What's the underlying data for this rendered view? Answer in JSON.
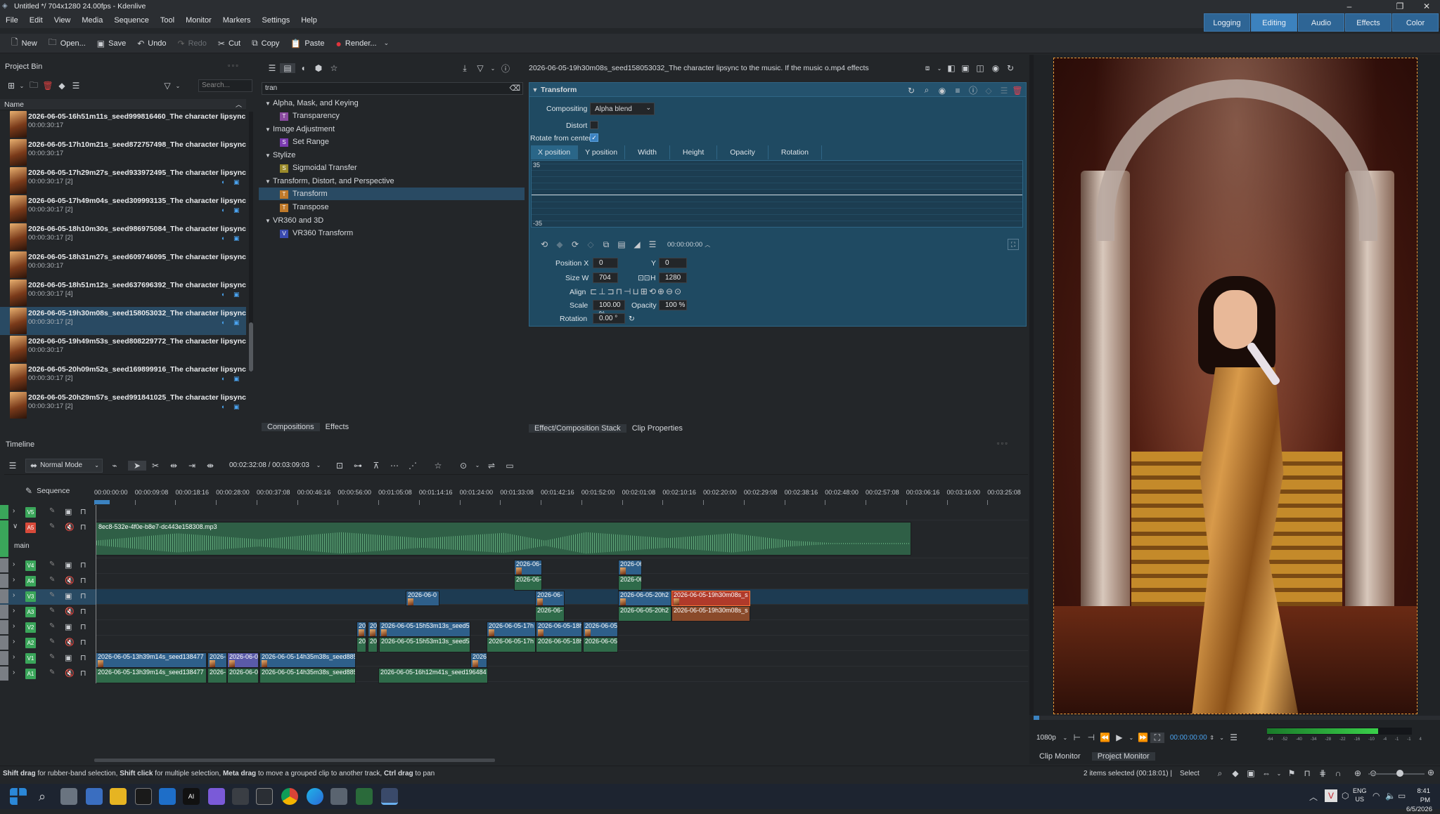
{
  "window": {
    "title": "Untitled */ 704x1280 24.00fps - Kdenlive"
  },
  "menu": [
    "File",
    "Edit",
    "View",
    "Media",
    "Sequence",
    "Tool",
    "Monitor",
    "Markers",
    "Settings",
    "Help"
  ],
  "workspace_tabs": [
    {
      "label": "Logging",
      "active": false
    },
    {
      "label": "Editing",
      "active": true
    },
    {
      "label": "Audio",
      "active": false
    },
    {
      "label": "Effects",
      "active": false
    },
    {
      "label": "Color",
      "active": false
    }
  ],
  "toolbar": {
    "new": "New",
    "open": "Open...",
    "save": "Save",
    "undo": "Undo",
    "redo": "Redo",
    "cut": "Cut",
    "copy": "Copy",
    "paste": "Paste",
    "render": "Render..."
  },
  "project_bin": {
    "title": "Project Bin",
    "search_placeholder": "Search...",
    "column_name": "Name",
    "clips": [
      {
        "name": "2026-06-05-16h51m11s_seed999816460_The character lipsync to the",
        "time": "00:00:30:17",
        "selected": false
      },
      {
        "name": "2026-06-05-17h10m21s_seed872757498_The character lipsync to the",
        "time": "00:00:30:17",
        "selected": false
      },
      {
        "name": "2026-06-05-17h29m27s_seed933972495_The character lipsync to the",
        "time": "00:00:30:17 [2]",
        "selected": false
      },
      {
        "name": "2026-06-05-17h49m04s_seed309993135_The character lipsync to the",
        "time": "00:00:30:17 [2]",
        "selected": false
      },
      {
        "name": "2026-06-05-18h10m30s_seed986975084_The character lipsync to the",
        "time": "00:00:30:17 [2]",
        "selected": false
      },
      {
        "name": "2026-06-05-18h31m27s_seed609746095_The character lipsync to the",
        "time": "00:00:30:17",
        "selected": false
      },
      {
        "name": "2026-06-05-18h51m12s_seed637696392_The character lipsync to the",
        "time": "00:00:30:17 [4]",
        "selected": false
      },
      {
        "name": "2026-06-05-19h30m08s_seed158053032_The character lipsync to the",
        "time": "00:00:30:17 [2]",
        "selected": true
      },
      {
        "name": "2026-06-05-19h49m53s_seed808229772_The character lipsync to the",
        "time": "00:00:30:17",
        "selected": false
      },
      {
        "name": "2026-06-05-20h09m52s_seed169899916_The character lipsync to the",
        "time": "00:00:30:17 [2]",
        "selected": false
      },
      {
        "name": "2026-06-05-20h29m57s_seed991841025_The character lipsync to the",
        "time": "00:00:30:17 [2]",
        "selected": false
      }
    ]
  },
  "effects_browser": {
    "filter": "tran",
    "tree": [
      {
        "group": "Alpha, Mask, and Keying",
        "items": [
          {
            "label": "Transparency",
            "color": "#8a4aa0",
            "letter": "T"
          }
        ]
      },
      {
        "group": "Image Adjustment",
        "items": [
          {
            "label": "Set Range",
            "color": "#7a3ab0",
            "letter": "S"
          }
        ]
      },
      {
        "group": "Stylize",
        "items": [
          {
            "label": "Sigmoidal Transfer",
            "color": "#9a8a2a",
            "letter": "S"
          }
        ]
      },
      {
        "group": "Transform, Distort, and Perspective",
        "items": [
          {
            "label": "Transform",
            "color": "#c07a2a",
            "letter": "T",
            "selected": true
          },
          {
            "label": "Transpose",
            "color": "#c07a2a",
            "letter": "T"
          }
        ]
      },
      {
        "group": "VR360 and 3D",
        "items": [
          {
            "label": "VR360 Transform",
            "color": "#3a4ab0",
            "letter": "V"
          }
        ]
      }
    ],
    "tabs": [
      "Compositions",
      "Effects"
    ]
  },
  "effect_stack": {
    "header": "2026-06-05-19h30m08s_seed158053032_The character lipsync to the music. If the music o.mp4 effects",
    "effect_name": "Transform",
    "compositing_label": "Compositing",
    "compositing_value": "Alpha blend",
    "distort_label": "Distort",
    "rotate_label": "Rotate from center",
    "kf_tabs": [
      "X position",
      "Y position",
      "Width",
      "Height",
      "Opacity",
      "Rotation"
    ],
    "graph_max": "35",
    "graph_min": "-35",
    "kf_time": "00:00:00:00",
    "position_x_label": "Position X",
    "position_x": "0",
    "y_label": "Y",
    "position_y": "0",
    "size_label": "Size W",
    "size_w": "704",
    "h_label": "H",
    "size_h": "1280",
    "align_label": "Align",
    "scale_label": "Scale",
    "scale": "100.00 %",
    "opacity_label": "Opacity",
    "opacity": "100 %",
    "rotation_label": "Rotation",
    "rotation": "0.00 °",
    "tabs": [
      "Effect/Composition Stack",
      "Clip Properties"
    ]
  },
  "monitor": {
    "resolution": "1080p",
    "timecode": "00:00:00:00",
    "tabs": [
      "Clip Monitor",
      "Project Monitor"
    ],
    "vu_ticks": [
      "-64",
      "-52",
      "-40",
      "-34",
      "-28",
      "-22",
      "-16",
      "-10",
      "-4",
      "-1",
      "-1",
      "4"
    ]
  },
  "timeline": {
    "title": "Timeline",
    "mode": "Normal Mode",
    "timecode": "00:02:32:08 / 00:03:09:03",
    "sequence": "Sequence",
    "ruler": [
      "00:00:00:00",
      "00:00:09:08",
      "00:00:18:16",
      "00:00:28:00",
      "00:00:37:08",
      "00:00:46:16",
      "00:00:56:00",
      "00:01:05:08",
      "00:01:14:16",
      "00:01:24:00",
      "00:01:33:08",
      "00:01:42:16",
      "00:01:52:00",
      "00:02:01:08",
      "00:02:10:16",
      "00:02:20:00",
      "00:02:29:08",
      "00:02:38:16",
      "00:02:48:00",
      "00:02:57:08",
      "00:03:06:16",
      "00:03:16:00",
      "00:03:25:08"
    ],
    "tracks": [
      "V5",
      "A5",
      "V4",
      "A4",
      "V3",
      "A3",
      "V2",
      "A2",
      "V1",
      "A1"
    ],
    "main_label": "main",
    "audio_clip": "8ec8-532e-4f0e-b8e7-dc443e158308.mp3",
    "clips": {
      "c1": "2026-06-",
      "c2": "2026-06",
      "c3": "2026-06-0",
      "c4": "2026-06-",
      "c5": "2026-06-05-20h2",
      "c6": "2026-06-05-19h30m08s_s",
      "c7": "202",
      "c8": "20",
      "c9": "2026-06-05-15h53m13s_seed5",
      "c10": "2026-06-05-17h",
      "c11": "2026-06-05-18h",
      "c12": "2026-06-05",
      "c13": "2026-06-05-13h39m14s_seed138477",
      "c14": "2026-",
      "c15": "2026-06-0",
      "c16": "2026-06-05-14h35m38s_seed885",
      "c17": "2026",
      "c18": "2026-06-05-16h12m41s_seed196484"
    }
  },
  "status": {
    "hint_b1": "Shift drag",
    "hint_t1": " for rubber-band selection, ",
    "hint_b2": "Shift click",
    "hint_t2": " for multiple selection, ",
    "hint_b3": "Meta drag",
    "hint_t3": " to move a grouped clip to another track, ",
    "hint_b4": "Ctrl drag",
    "hint_t4": " to pan",
    "selection": "2 items selected (00:18:01) |",
    "tool": "Select"
  },
  "taskbar": {
    "lang": "ENG",
    "region": "US",
    "time": "8:41 PM",
    "date": "6/5/2026"
  }
}
